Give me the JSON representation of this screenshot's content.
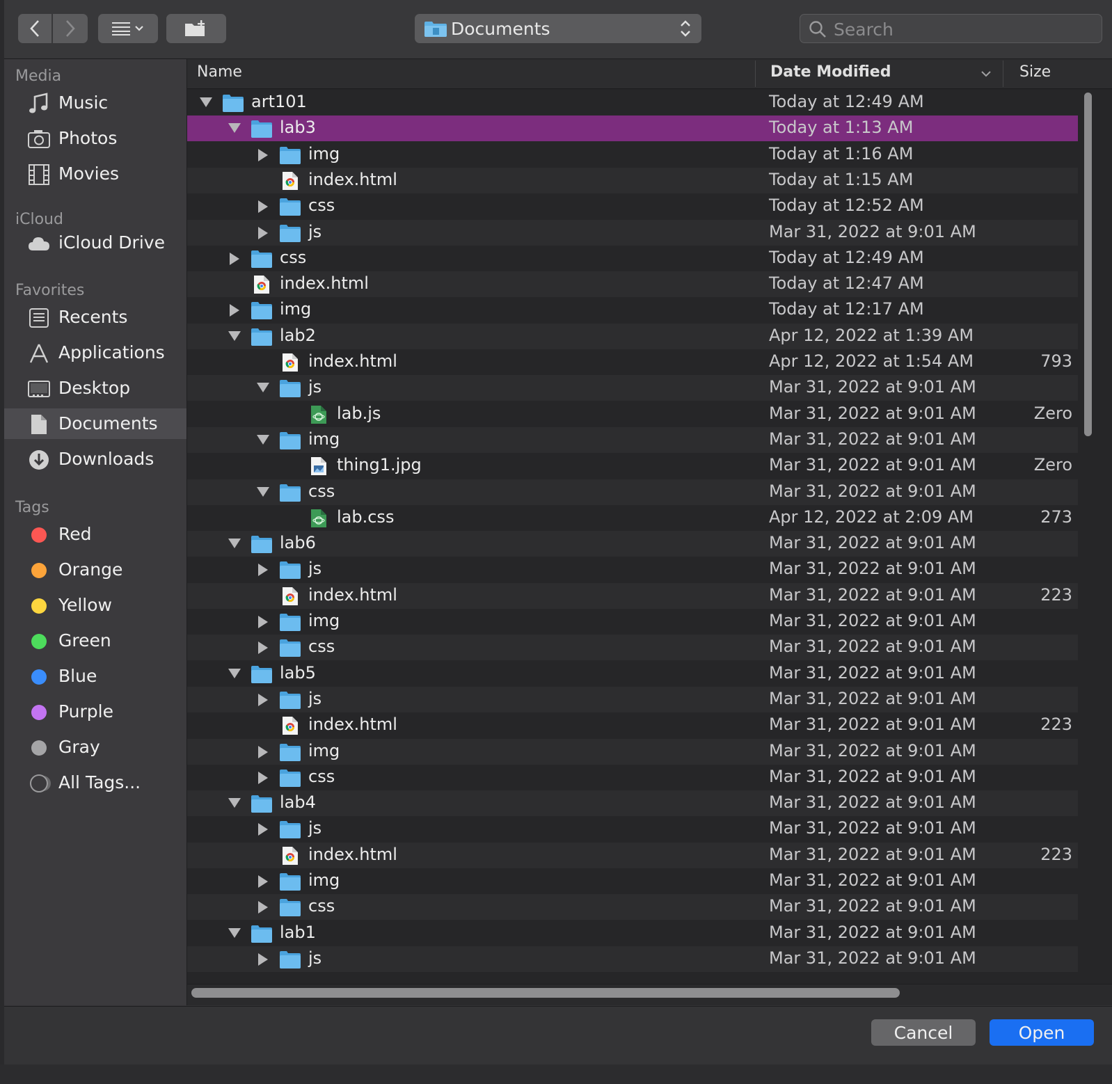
{
  "toolbar": {
    "path_label": "Documents",
    "search_placeholder": "Search"
  },
  "sidebar": {
    "sections": [
      {
        "title": "Media",
        "items": [
          {
            "label": "Music",
            "icon": "music-icon"
          },
          {
            "label": "Photos",
            "icon": "camera-icon"
          },
          {
            "label": "Movies",
            "icon": "film-icon"
          }
        ]
      },
      {
        "title": "iCloud",
        "items": [
          {
            "label": "iCloud Drive",
            "icon": "cloud-icon"
          }
        ]
      },
      {
        "title": "Favorites",
        "items": [
          {
            "label": "Recents",
            "icon": "clock-icon"
          },
          {
            "label": "Applications",
            "icon": "applications-icon"
          },
          {
            "label": "Desktop",
            "icon": "desktop-icon"
          },
          {
            "label": "Documents",
            "icon": "document-icon",
            "selected": true
          },
          {
            "label": "Downloads",
            "icon": "download-icon"
          }
        ]
      },
      {
        "title": "Tags",
        "items": [
          {
            "label": "Red",
            "color": "#fc5753"
          },
          {
            "label": "Orange",
            "color": "#fda43a"
          },
          {
            "label": "Yellow",
            "color": "#fdd63f"
          },
          {
            "label": "Green",
            "color": "#4ddc5c"
          },
          {
            "label": "Blue",
            "color": "#3a8dfc"
          },
          {
            "label": "Purple",
            "color": "#c374f2"
          },
          {
            "label": "Gray",
            "color": "#a5a5a7"
          },
          {
            "label": "All Tags...",
            "color": "all"
          }
        ]
      }
    ]
  },
  "columns": {
    "name": "Name",
    "date": "Date Modified",
    "size": "Size"
  },
  "files": [
    {
      "name": "art101",
      "depth": 0,
      "type": "folder",
      "state": "open",
      "date": "Today at 12:49 AM",
      "size": ""
    },
    {
      "name": "lab3",
      "depth": 1,
      "type": "folder",
      "state": "open",
      "date": "Today at 1:13 AM",
      "size": "",
      "selected": true
    },
    {
      "name": "img",
      "depth": 2,
      "type": "folder",
      "state": "closed",
      "date": "Today at 1:16 AM",
      "size": ""
    },
    {
      "name": "index.html",
      "depth": 2,
      "type": "html",
      "state": "",
      "date": "Today at 1:15 AM",
      "size": ""
    },
    {
      "name": "css",
      "depth": 2,
      "type": "folder",
      "state": "closed",
      "date": "Today at 12:52 AM",
      "size": ""
    },
    {
      "name": "js",
      "depth": 2,
      "type": "folder",
      "state": "closed",
      "date": "Mar 31, 2022 at 9:01 AM",
      "size": ""
    },
    {
      "name": "css",
      "depth": 1,
      "type": "folder",
      "state": "closed",
      "date": "Today at 12:49 AM",
      "size": ""
    },
    {
      "name": "index.html",
      "depth": 1,
      "type": "html",
      "state": "",
      "date": "Today at 12:47 AM",
      "size": ""
    },
    {
      "name": "img",
      "depth": 1,
      "type": "folder",
      "state": "closed",
      "date": "Today at 12:17 AM",
      "size": ""
    },
    {
      "name": "lab2",
      "depth": 1,
      "type": "folder",
      "state": "open",
      "date": "Apr 12, 2022 at 1:39 AM",
      "size": ""
    },
    {
      "name": "index.html",
      "depth": 2,
      "type": "html",
      "state": "",
      "date": "Apr 12, 2022 at 1:54 AM",
      "size": "793"
    },
    {
      "name": "js",
      "depth": 2,
      "type": "folder",
      "state": "open",
      "date": "Mar 31, 2022 at 9:01 AM",
      "size": ""
    },
    {
      "name": "lab.js",
      "depth": 3,
      "type": "code",
      "state": "",
      "date": "Mar 31, 2022 at 9:01 AM",
      "size": "Zero"
    },
    {
      "name": "img",
      "depth": 2,
      "type": "folder",
      "state": "open",
      "date": "Mar 31, 2022 at 9:01 AM",
      "size": ""
    },
    {
      "name": "thing1.jpg",
      "depth": 3,
      "type": "image",
      "state": "",
      "date": "Mar 31, 2022 at 9:01 AM",
      "size": "Zero"
    },
    {
      "name": "css",
      "depth": 2,
      "type": "folder",
      "state": "open",
      "date": "Mar 31, 2022 at 9:01 AM",
      "size": ""
    },
    {
      "name": "lab.css",
      "depth": 3,
      "type": "code",
      "state": "",
      "date": "Apr 12, 2022 at 2:09 AM",
      "size": "273"
    },
    {
      "name": "lab6",
      "depth": 1,
      "type": "folder",
      "state": "open",
      "date": "Mar 31, 2022 at 9:01 AM",
      "size": ""
    },
    {
      "name": "js",
      "depth": 2,
      "type": "folder",
      "state": "closed",
      "date": "Mar 31, 2022 at 9:01 AM",
      "size": ""
    },
    {
      "name": "index.html",
      "depth": 2,
      "type": "html",
      "state": "",
      "date": "Mar 31, 2022 at 9:01 AM",
      "size": "223"
    },
    {
      "name": "img",
      "depth": 2,
      "type": "folder",
      "state": "closed",
      "date": "Mar 31, 2022 at 9:01 AM",
      "size": ""
    },
    {
      "name": "css",
      "depth": 2,
      "type": "folder",
      "state": "closed",
      "date": "Mar 31, 2022 at 9:01 AM",
      "size": ""
    },
    {
      "name": "lab5",
      "depth": 1,
      "type": "folder",
      "state": "open",
      "date": "Mar 31, 2022 at 9:01 AM",
      "size": ""
    },
    {
      "name": "js",
      "depth": 2,
      "type": "folder",
      "state": "closed",
      "date": "Mar 31, 2022 at 9:01 AM",
      "size": ""
    },
    {
      "name": "index.html",
      "depth": 2,
      "type": "html",
      "state": "",
      "date": "Mar 31, 2022 at 9:01 AM",
      "size": "223"
    },
    {
      "name": "img",
      "depth": 2,
      "type": "folder",
      "state": "closed",
      "date": "Mar 31, 2022 at 9:01 AM",
      "size": ""
    },
    {
      "name": "css",
      "depth": 2,
      "type": "folder",
      "state": "closed",
      "date": "Mar 31, 2022 at 9:01 AM",
      "size": ""
    },
    {
      "name": "lab4",
      "depth": 1,
      "type": "folder",
      "state": "open",
      "date": "Mar 31, 2022 at 9:01 AM",
      "size": ""
    },
    {
      "name": "js",
      "depth": 2,
      "type": "folder",
      "state": "closed",
      "date": "Mar 31, 2022 at 9:01 AM",
      "size": ""
    },
    {
      "name": "index.html",
      "depth": 2,
      "type": "html",
      "state": "",
      "date": "Mar 31, 2022 at 9:01 AM",
      "size": "223"
    },
    {
      "name": "img",
      "depth": 2,
      "type": "folder",
      "state": "closed",
      "date": "Mar 31, 2022 at 9:01 AM",
      "size": ""
    },
    {
      "name": "css",
      "depth": 2,
      "type": "folder",
      "state": "closed",
      "date": "Mar 31, 2022 at 9:01 AM",
      "size": ""
    },
    {
      "name": "lab1",
      "depth": 1,
      "type": "folder",
      "state": "open",
      "date": "Mar 31, 2022 at 9:01 AM",
      "size": ""
    },
    {
      "name": "js",
      "depth": 2,
      "type": "folder",
      "state": "closed",
      "date": "Mar 31, 2022 at 9:01 AM",
      "size": ""
    }
  ],
  "footer": {
    "cancel_label": "Cancel",
    "open_label": "Open"
  },
  "colors": {
    "selection": "#7c2d7e",
    "open_button": "#1a6ff2",
    "folder": "#5fb2e6"
  }
}
